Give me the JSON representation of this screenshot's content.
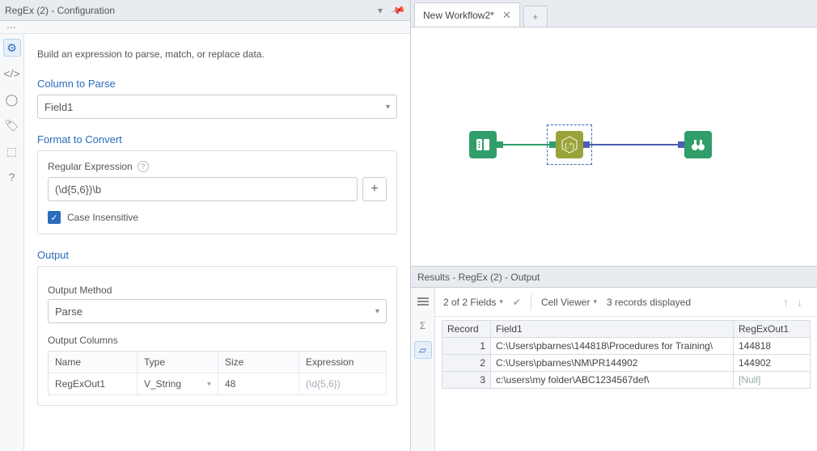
{
  "config": {
    "header_title": "RegEx (2) - Configuration",
    "intro": "Build an expression to parse, match, or replace data.",
    "column_label": "Column to Parse",
    "column_value": "Field1",
    "format_label": "Format to Convert",
    "regex_label": "Regular Expression",
    "regex_value": "(\\d{5,6})\\b",
    "case_label": "Case Insensitive",
    "output_label": "Output",
    "method_label": "Output Method",
    "method_value": "Parse",
    "columns_label": "Output Columns",
    "col_headers": {
      "name": "Name",
      "type": "Type",
      "size": "Size",
      "expr": "Expression"
    },
    "col_row": {
      "name": "RegExOut1",
      "type": "V_String",
      "size": "48",
      "expr": "(\\d{5,6})"
    }
  },
  "workflow": {
    "tab_label": "New Workflow2*"
  },
  "results": {
    "header": "Results - RegEx (2) - Output",
    "fields_text": "2 of 2 Fields",
    "viewer_text": "Cell Viewer",
    "records_text": "3 records displayed",
    "headers": {
      "record": "Record",
      "f1": "Field1",
      "out": "RegExOut1"
    },
    "rows": [
      {
        "rec": "1",
        "f1": "C:\\Users\\pbarnes\\144818\\Procedures for Training\\",
        "out": "144818"
      },
      {
        "rec": "2",
        "f1": "C:\\Users\\pbarnes\\NM\\PR144902",
        "out": "144902"
      },
      {
        "rec": "3",
        "f1": "c:\\users\\my folder\\ABC1234567def\\",
        "out": "[Null]"
      }
    ]
  }
}
